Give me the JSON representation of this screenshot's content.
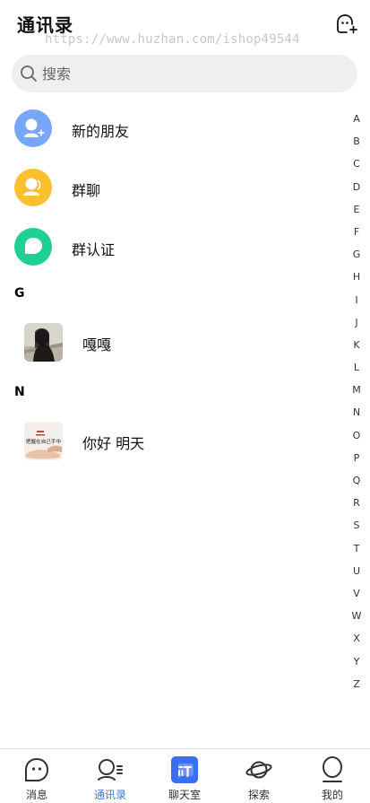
{
  "header": {
    "title": "通讯录",
    "watermark": "https://www.huzhan.com/ishop49544",
    "add_icon": "add-friend-icon"
  },
  "search": {
    "placeholder": "搜索",
    "icon": "search-icon"
  },
  "fixed_items": [
    {
      "label": "新的朋友",
      "icon": "new-friend-icon",
      "color": "#78a6fb"
    },
    {
      "label": "群聊",
      "icon": "group-chat-icon",
      "color": "#fbc02d"
    },
    {
      "label": "群认证",
      "icon": "group-verify-icon",
      "color": "#1fd095"
    }
  ],
  "sections": [
    {
      "letter": "G",
      "contacts": [
        {
          "name": "嘎嘎"
        }
      ]
    },
    {
      "letter": "N",
      "contacts": [
        {
          "name": "你好 明天",
          "thumb_text": "把握在自己手中"
        }
      ]
    }
  ],
  "index_letters": [
    "A",
    "B",
    "C",
    "D",
    "E",
    "F",
    "G",
    "H",
    "I",
    "J",
    "K",
    "L",
    "M",
    "N",
    "O",
    "P",
    "Q",
    "R",
    "S",
    "T",
    "U",
    "V",
    "W",
    "X",
    "Y",
    "Z"
  ],
  "tabbar": {
    "active_color": "#3a7bd5",
    "tabs": [
      {
        "label": "消息",
        "icon": "message-icon",
        "active": false
      },
      {
        "label": "通讯录",
        "icon": "contacts-icon",
        "active": true
      },
      {
        "label": "聊天室",
        "icon": "chatroom-icon",
        "active": false
      },
      {
        "label": "探索",
        "icon": "planet-icon",
        "active": false
      },
      {
        "label": "我的",
        "icon": "profile-icon",
        "active": false
      }
    ]
  }
}
